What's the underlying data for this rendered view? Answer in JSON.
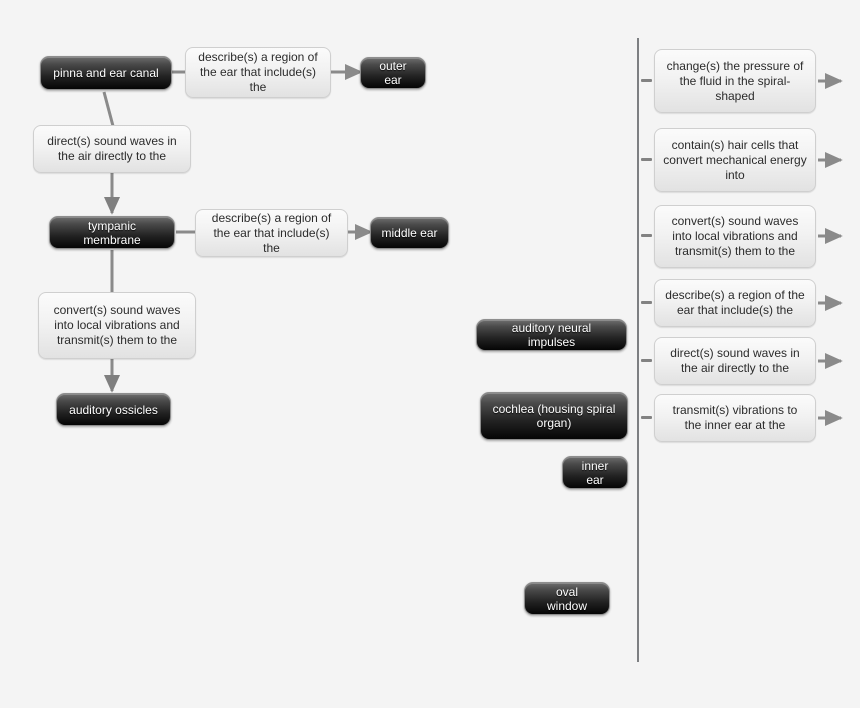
{
  "diagram": {
    "title": "ear anatomy concept map",
    "background_color": "#f4f4f4",
    "divider_color": "#7d7f82",
    "node_text_color": "#ffffff",
    "card_text_color": "#2b2b2b"
  },
  "placed_nodes": [
    {
      "id": "pinna",
      "label": "pinna and ear canal"
    },
    {
      "id": "outer_ear",
      "label": "outer ear"
    },
    {
      "id": "tympanic",
      "label": "tympanic membrane"
    },
    {
      "id": "middle_ear",
      "label": "middle ear"
    },
    {
      "id": "ossicles",
      "label": "auditory ossicles"
    }
  ],
  "placed_cards": [
    {
      "id": "card_describe_1",
      "label": "describe(s) a region of the ear that include(s) the"
    },
    {
      "id": "card_direct",
      "label": "direct(s) sound waves in the air directly to the"
    },
    {
      "id": "card_describe_2",
      "label": "describe(s) a region of the ear that include(s) the"
    },
    {
      "id": "card_convert",
      "label": "convert(s) sound waves into local vibrations and transmit(s) them to the"
    }
  ],
  "bank_nodes": [
    {
      "id": "bank_impulses",
      "label": "auditory neural impulses"
    },
    {
      "id": "bank_cochlea",
      "label": "cochlea (housing spiral organ)"
    },
    {
      "id": "bank_inner_ear",
      "label": "inner ear"
    },
    {
      "id": "bank_oval_window",
      "label": "oval window"
    }
  ],
  "bank_cards": [
    {
      "id": "bank_card_1",
      "label": "change(s) the pressure of the fluid in the spiral-shaped"
    },
    {
      "id": "bank_card_2",
      "label": "contain(s) hair cells that convert mechanical energy into"
    },
    {
      "id": "bank_card_3",
      "label": "convert(s) sound waves into local vibrations and transmit(s) them to the"
    },
    {
      "id": "bank_card_4",
      "label": "describe(s) a region of the ear that include(s) the"
    },
    {
      "id": "bank_card_5",
      "label": "direct(s) sound waves in the air directly to the"
    },
    {
      "id": "bank_card_6",
      "label": "transmit(s) vibrations to the inner ear at the"
    }
  ]
}
